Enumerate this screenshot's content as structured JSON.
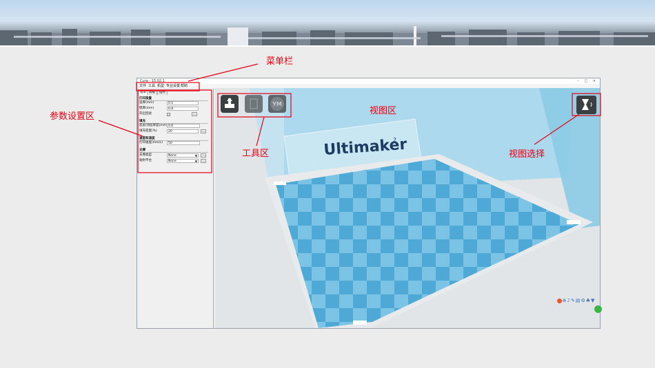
{
  "annotations": {
    "menu_bar": "菜单栏",
    "param_area": "参数设置区",
    "tool_area": "工具区",
    "view_area": "视图区",
    "view_select": "视图选择"
  },
  "window": {
    "title": "Cura - 15.02.1",
    "menu": [
      "文件",
      "工具",
      "机型",
      "专业设置",
      "帮助"
    ]
  },
  "panel": {
    "tabs": [
      "基本",
      "高级",
      "插件"
    ],
    "sections": [
      {
        "title": "打印质量",
        "fields": [
          {
            "label": "层厚(mm)",
            "value": "0.1"
          },
          {
            "label": "壁厚(mm)",
            "value": "0.8"
          },
          {
            "label": "开启回退",
            "value": "✓"
          }
        ]
      },
      {
        "title": "填充",
        "fields": [
          {
            "label": "底层/顶层厚度(mm)",
            "value": "0.6"
          },
          {
            "label": "填充密度(%)",
            "value": "20"
          }
        ]
      },
      {
        "title": "速度和温度",
        "fields": [
          {
            "label": "打印速度(mm/s)",
            "value": "50"
          }
        ]
      },
      {
        "title": "支撑",
        "fields": [
          {
            "label": "支撑类型",
            "value": "None"
          },
          {
            "label": "粘附平台",
            "value": "None"
          }
        ]
      }
    ]
  },
  "viewport": {
    "brand": "Ultimaker",
    "brand_sup": "2",
    "tool_icons": [
      "load-model-icon",
      "save-sd-icon",
      "youmagine-icon"
    ],
    "tool_text": "YM",
    "view_icon": "view-mode-icon"
  },
  "colors": {
    "annotation": "#e60012",
    "plate_blue": "#4fa9d6",
    "plate_light": "#7cc4e6",
    "wall": "#9fd3ea"
  }
}
